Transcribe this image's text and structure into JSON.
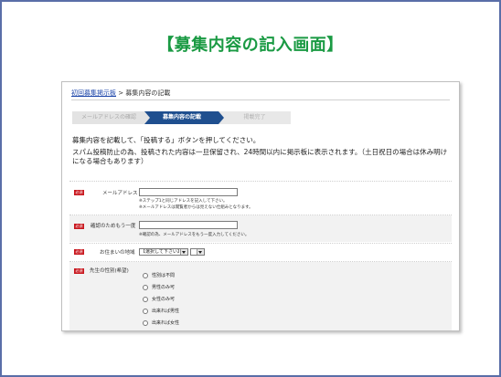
{
  "slide": {
    "title": "【募集内容の記入画面】"
  },
  "breadcrumb": {
    "home": "初回募集掲示板",
    "separator": " > ",
    "current": "募集内容の記載"
  },
  "steps": [
    "メールアドレスの確認",
    "募集内容の記載",
    "掲載完了"
  ],
  "instruction": "募集内容を記載して、「投稿する」ボタンを押してください。",
  "note": "スパム投稿防止の為、投稿された内容は一旦保留され、24時間以内に掲示板に表示されます。（土日祝日の場合は休み明けになる場合もあります）",
  "form": {
    "required_badge": "必須",
    "email": {
      "label": "メールアドレス",
      "value": "",
      "hint1": "※ステップ1と同じアドレスを記入して下さい。",
      "hint2": "※メールアドレスは閲覧者からは見えない仕組みとなります。"
    },
    "confirm": {
      "label": "確認のためもう一度",
      "value": "",
      "hint": "※確認の為、メールアドレスをもう一度入力してください。"
    },
    "area": {
      "label": "お住まいの地域",
      "selected": "【選択して下さい】",
      "sub_selected": ""
    },
    "teacher_gender": {
      "label": "先生の性別(希望)",
      "options": [
        "性別は不問",
        "男性のみ可",
        "女性のみ可",
        "出来れば男性",
        "出来れば女性"
      ]
    }
  }
}
